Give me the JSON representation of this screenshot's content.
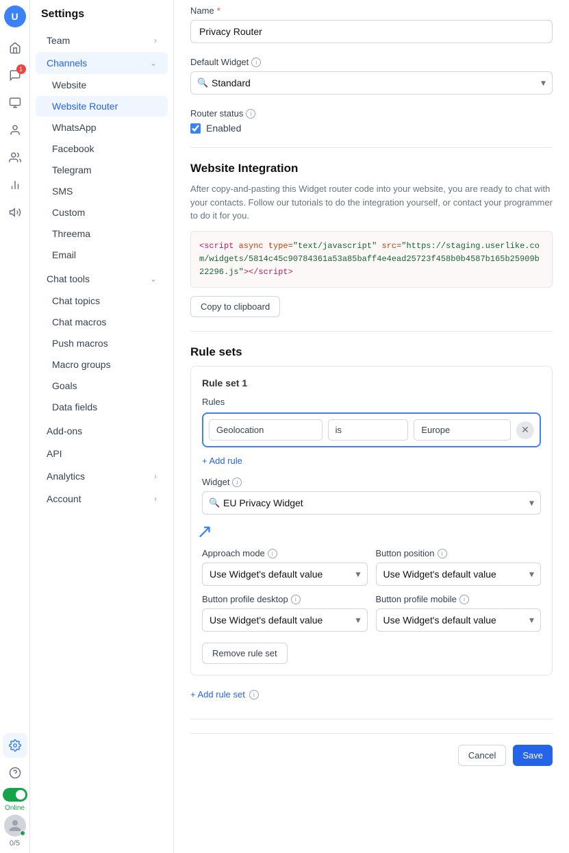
{
  "app": {
    "title": "Settings",
    "logo": "U"
  },
  "sidebar": {
    "title": "Settings",
    "items": [
      {
        "id": "team",
        "label": "Team",
        "hasChevron": true,
        "active": false
      },
      {
        "id": "channels",
        "label": "Channels",
        "hasChevron": true,
        "active": true,
        "expanded": true,
        "children": [
          {
            "id": "website",
            "label": "Website",
            "active": false
          },
          {
            "id": "website-router",
            "label": "Website Router",
            "active": true
          },
          {
            "id": "whatsapp",
            "label": "WhatsApp",
            "active": false
          },
          {
            "id": "facebook",
            "label": "Facebook",
            "active": false
          },
          {
            "id": "telegram",
            "label": "Telegram",
            "active": false
          },
          {
            "id": "sms",
            "label": "SMS",
            "active": false
          },
          {
            "id": "custom",
            "label": "Custom",
            "active": false
          },
          {
            "id": "threema",
            "label": "Threema",
            "active": false
          },
          {
            "id": "email",
            "label": "Email",
            "active": false
          }
        ]
      },
      {
        "id": "chat-tools",
        "label": "Chat tools",
        "hasChevron": true,
        "active": false,
        "expanded": true,
        "children": [
          {
            "id": "chat-topics",
            "label": "Chat topics",
            "active": false
          },
          {
            "id": "chat-macros",
            "label": "Chat macros",
            "active": false
          },
          {
            "id": "push-macros",
            "label": "Push macros",
            "active": false
          },
          {
            "id": "macro-groups",
            "label": "Macro groups",
            "active": false
          },
          {
            "id": "goals",
            "label": "Goals",
            "active": false
          },
          {
            "id": "data-fields",
            "label": "Data fields",
            "active": false
          }
        ]
      },
      {
        "id": "add-ons",
        "label": "Add-ons",
        "hasChevron": false,
        "active": false
      },
      {
        "id": "api",
        "label": "API",
        "hasChevron": false,
        "active": false
      },
      {
        "id": "analytics",
        "label": "Analytics",
        "hasChevron": true,
        "active": false
      },
      {
        "id": "account",
        "label": "Account",
        "hasChevron": true,
        "active": false
      }
    ]
  },
  "form": {
    "name_label": "Name",
    "name_required": "*",
    "name_value": "Privacy Router",
    "default_widget_label": "Default Widget",
    "default_widget_value": "Standard",
    "router_status_label": "Router status",
    "router_enabled_label": "Enabled",
    "router_enabled": true
  },
  "website_integration": {
    "heading": "Website Integration",
    "description": "After copy-and-pasting this Widget router code into your website, you are ready to chat with your contacts. Follow our tutorials to do the integration yourself, or contact your programmer to do it for you.",
    "code": "<script async type=\"text/javascript\" src=\"https://staging.userlike.com/widgets/5814c45c90784361a53a85baff4e4ead25723f458b0b4587b165b25909b22296.js\"><\\/script>",
    "copy_button": "Copy to clipboard"
  },
  "rule_sets": {
    "heading": "Rule sets",
    "rule_set_1": {
      "title": "Rule set 1",
      "rules_label": "Rules",
      "rule": {
        "condition": "Geolocation",
        "operator": "is",
        "value": "Europe"
      },
      "add_rule_label": "+ Add rule",
      "widget_label": "Widget",
      "widget_value": "EU Privacy Widget",
      "approach_mode_label": "Approach mode",
      "approach_mode_value": "Use Widget's default value",
      "button_position_label": "Button position",
      "button_position_value": "Use Widget's default value",
      "button_profile_desktop_label": "Button profile desktop",
      "button_profile_desktop_value": "Use Widget's default value",
      "button_profile_mobile_label": "Button profile mobile",
      "button_profile_mobile_value": "Use Widget's default value",
      "remove_button": "Remove rule set"
    },
    "add_ruleset_label": "+ Add rule set"
  },
  "footer": {
    "cancel_label": "Cancel",
    "save_label": "Save"
  },
  "nav_icons": [
    {
      "id": "home",
      "icon": "⌂"
    },
    {
      "id": "chat",
      "icon": "💬",
      "badge": "1"
    },
    {
      "id": "inbox",
      "icon": "☰"
    },
    {
      "id": "contacts",
      "icon": "👤"
    },
    {
      "id": "team",
      "icon": "👥"
    },
    {
      "id": "analytics",
      "icon": "📊"
    },
    {
      "id": "megaphone",
      "icon": "📢"
    }
  ],
  "status": {
    "online_label": "Online",
    "counter": "0/5"
  }
}
